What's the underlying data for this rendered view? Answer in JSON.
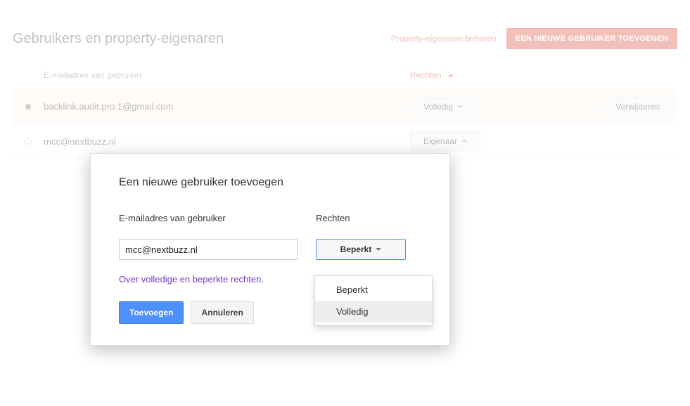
{
  "page": {
    "title": "Gebruikers en property-eigenaren",
    "manage_owners_link": "Property-eigenaren beheren",
    "add_user_button": "EEN NIEUWE GEBRUIKER TOEVOEGEN"
  },
  "table": {
    "headers": {
      "email": "E-mailadres van gebruiker",
      "permissions": "Rechten"
    },
    "rows": [
      {
        "indicator": "filled",
        "email": "backlink.audit.pro.1@gmail.com",
        "permission_label": "Volledig",
        "action_label": "Verwijderen",
        "highlight": true
      },
      {
        "indicator": "empty",
        "email": "mcc@nextbuzz.nl",
        "permission_label": "Eigenaar",
        "action_label": "",
        "highlight": false
      }
    ]
  },
  "modal": {
    "title": "Een nieuwe gebruiker toevoegen",
    "email_label": "E-mailadres van gebruiker",
    "perm_label": "Rechten",
    "email_value": "mcc@nextbuzz.nl",
    "perm_selected": "Beperkt",
    "help_link": "Over volledige en beperkte rechten.",
    "add_button": "Toevoegen",
    "cancel_button": "Annuleren",
    "dropdown": {
      "options": [
        "Beperkt",
        "Volledig"
      ],
      "hover_index": 1
    }
  }
}
